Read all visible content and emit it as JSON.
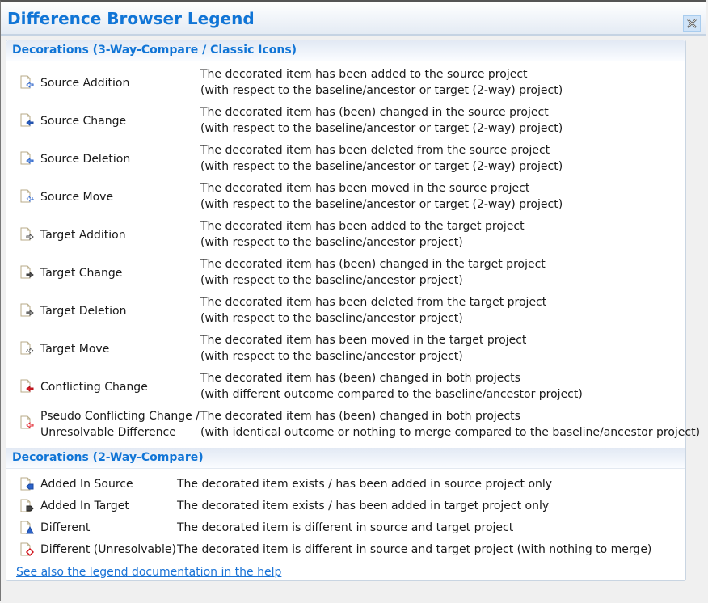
{
  "window": {
    "title": "Difference Browser Legend",
    "close_icon": "close-icon"
  },
  "sections": [
    {
      "title": "Decorations (3-Way-Compare / Classic Icons)",
      "items": [
        {
          "label": "Source Addition",
          "icon": "source-addition-icon",
          "desc1": "The decorated item has been added to the source project",
          "desc2": "(with respect to the baseline/ancestor or target (2-way) project)"
        },
        {
          "label": "Source Change",
          "icon": "source-change-icon",
          "desc1": "The decorated item has (been) changed in the source project",
          "desc2": "(with respect to the baseline/ancestor or target (2-way) project)"
        },
        {
          "label": "Source Deletion",
          "icon": "source-deletion-icon",
          "desc1": "The decorated item has been deleted from the source project",
          "desc2": "(with respect to the baseline/ancestor or target (2-way) project)"
        },
        {
          "label": "Source Move",
          "icon": "source-move-icon",
          "desc1": "The decorated item has been moved in the source project",
          "desc2": "(with respect to the baseline/ancestor or target (2-way) project)"
        },
        {
          "label": "Target Addition",
          "icon": "target-addition-icon",
          "desc1": "The decorated item has been added to the target project",
          "desc2": "(with respect to the baseline/ancestor project)"
        },
        {
          "label": "Target Change",
          "icon": "target-change-icon",
          "desc1": "The decorated item has (been) changed in the target project",
          "desc2": "(with respect to the baseline/ancestor project)"
        },
        {
          "label": "Target Deletion",
          "icon": "target-deletion-icon",
          "desc1": "The decorated item has been deleted from the target project",
          "desc2": "(with respect to the baseline/ancestor project)"
        },
        {
          "label": "Target Move",
          "icon": "target-move-icon",
          "desc1": "The decorated item has been moved in the target project",
          "desc2": "(with respect to the baseline/ancestor project)"
        },
        {
          "label": "Conflicting Change",
          "icon": "conflicting-change-icon",
          "desc1": "The decorated item has (been) changed in both projects",
          "desc2": "(with different outcome compared to the baseline/ancestor project)"
        },
        {
          "label": "Pseudo Conflicting Change /",
          "label2": "Unresolvable Difference",
          "icon": "pseudo-conflict-icon",
          "desc1": "The decorated item has (been) changed in both projects",
          "desc2": "(with identical outcome or nothing to merge compared to the baseline/ancestor project)"
        }
      ]
    },
    {
      "title": "Decorations (2-Way-Compare)",
      "items": [
        {
          "label": "Added In Source",
          "icon": "added-in-source-icon",
          "desc1": "The decorated item exists / has been added in source project only"
        },
        {
          "label": "Added In Target",
          "icon": "added-in-target-icon",
          "desc1": "The decorated item exists / has been added in target project only"
        },
        {
          "label": "Different",
          "icon": "different-icon",
          "desc1": "The decorated item is different in source and target project"
        },
        {
          "label": "Different (Unresolvable)",
          "icon": "different-unresolvable-icon",
          "desc1": "The decorated item is different in source and target project (with nothing to merge)"
        }
      ]
    }
  ],
  "help_link": "See also the legend documentation in the help",
  "colors": {
    "accent": "#1175d6",
    "source": "#2a62c9",
    "target": "#444444",
    "conflict": "#e0202a"
  }
}
